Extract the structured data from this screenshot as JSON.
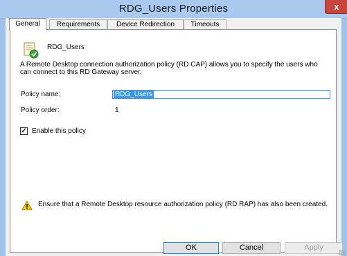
{
  "window": {
    "title": "RDG_Users  Properties",
    "close_glyph": "x"
  },
  "tabs": [
    {
      "label": "General",
      "selected": true
    },
    {
      "label": "Requirements",
      "selected": false
    },
    {
      "label": "Device Redirection",
      "selected": false
    },
    {
      "label": "Timeouts",
      "selected": false
    }
  ],
  "general": {
    "policy_icon": "policy-check-icon",
    "policy_display_name": "RDG_Users",
    "description": "A Remote Desktop connection authorization policy (RD CAP) allows you to specify the users who can connect to this RD Gateway server.",
    "policy_name_label": "Policy name:",
    "policy_name_value": "RDG_Users",
    "policy_order_label": "Policy order:",
    "policy_order_value": "1",
    "enable_label": "Enable this policy",
    "enable_checked": true,
    "check_glyph": "✓",
    "warning_icon": "warning-icon",
    "warning_text": "Ensure that a Remote Desktop resource authorization policy (RD RAP) has also been created."
  },
  "buttons": {
    "ok": "OK",
    "cancel": "Cancel",
    "apply": "Apply",
    "apply_enabled": false
  },
  "colors": {
    "title_bar": "#a9c9ef",
    "close_button": "#c7453a",
    "selection": "#3399ff",
    "warning": "#f5c400"
  }
}
